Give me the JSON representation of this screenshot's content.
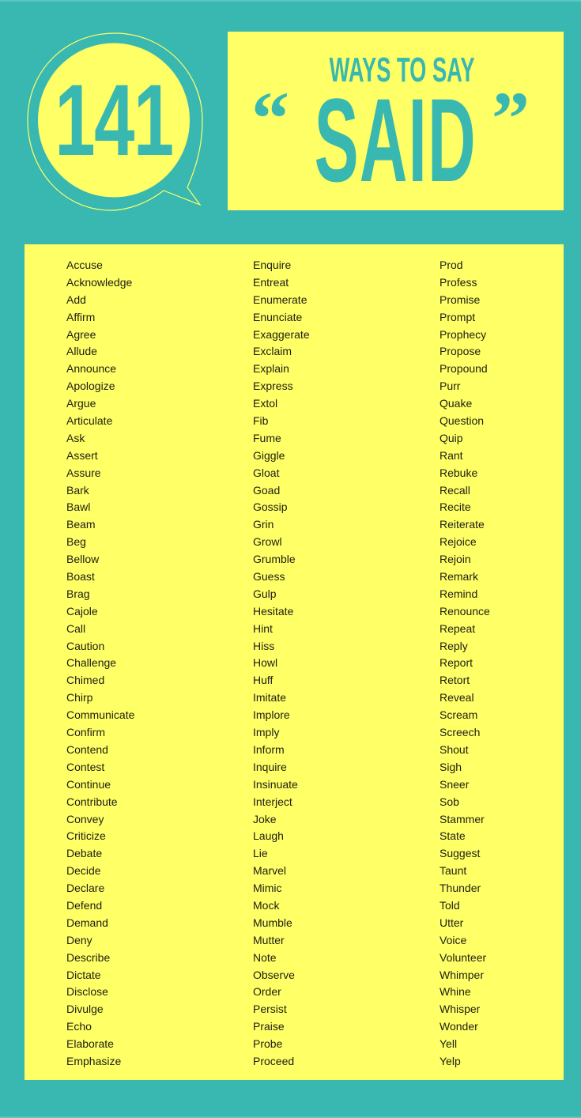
{
  "header": {
    "count": "141",
    "subtitle": "WAYS TO SAY",
    "title_word": "SAID",
    "open_quote": "“",
    "close_quote": "”"
  },
  "colors": {
    "background": "#38b8b0",
    "accent_yellow": "#ffff66",
    "text_dark": "#1e1e14"
  },
  "words": {
    "columns": [
      [
        "Accuse",
        "Acknowledge",
        "Add",
        "Affirm",
        "Agree",
        "Allude",
        "Announce",
        "Apologize",
        "Argue",
        "Articulate",
        "Ask",
        "Assert",
        "Assure",
        "Bark",
        "Bawl",
        "Beam",
        "Beg",
        "Bellow",
        "Boast",
        "Brag",
        "Cajole",
        "Call",
        "Caution",
        "Challenge",
        "Chimed",
        "Chirp",
        "Communicate",
        "Confirm",
        "Contend",
        "Contest",
        "Continue",
        "Contribute",
        "Convey",
        "Criticize",
        "Debate",
        "Decide",
        "Declare",
        "Defend",
        "Demand",
        "Deny",
        "Describe",
        "Dictate",
        "Disclose",
        "Divulge",
        "Echo",
        "Elaborate",
        "Emphasize"
      ],
      [
        "Enquire",
        "Entreat",
        "Enumerate",
        "Enunciate",
        "Exaggerate",
        "Exclaim",
        "Explain",
        "Express",
        "Extol",
        "Fib",
        "Fume",
        "Giggle",
        "Gloat",
        "Goad",
        "Gossip",
        "Grin",
        "Growl",
        "Grumble",
        "Guess",
        "Gulp",
        "Hesitate",
        "Hint",
        "Hiss",
        "Howl",
        "Huff",
        "Imitate",
        "Implore",
        "Imply",
        "Inform",
        "Inquire",
        "Insinuate",
        "Interject",
        "Joke",
        "Laugh",
        "Lie",
        "Marvel",
        "Mimic",
        "Mock",
        "Mumble",
        "Mutter",
        "Note",
        "Observe",
        "Order",
        "Persist",
        "Praise",
        "Probe",
        "Proceed"
      ],
      [
        "Prod",
        "Profess",
        "Promise",
        "Prompt",
        "Prophecy",
        "Propose",
        "Propound",
        "Purr",
        "Quake",
        "Question",
        "Quip",
        "Rant",
        "Rebuke",
        "Recall",
        "Recite",
        "Reiterate",
        "Rejoice",
        "Rejoin",
        "Remark",
        "Remind",
        "Renounce",
        "Repeat",
        "Reply",
        "Report",
        "Retort",
        "Reveal",
        "Scream",
        "Screech",
        "Shout",
        "Sigh",
        "Sneer",
        "Sob",
        "Stammer",
        "State",
        "Suggest",
        "Taunt",
        "Thunder",
        "Told",
        "Utter",
        "Voice",
        "Volunteer",
        "Whimper",
        "Whine",
        "Whisper",
        "Wonder",
        "Yell",
        "Yelp"
      ]
    ]
  }
}
